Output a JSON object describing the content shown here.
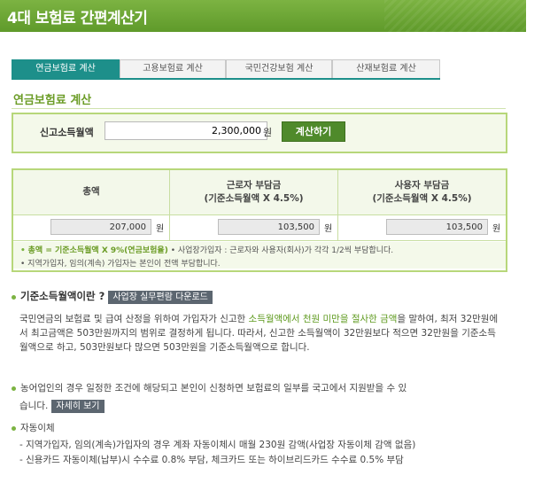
{
  "header": {
    "title": "4대 보험료 간편계산기"
  },
  "tabs": [
    {
      "label": "연금보험료 계산",
      "active": true
    },
    {
      "label": "고용보험료 계산",
      "active": false
    },
    {
      "label": "국민건강보험 계산",
      "active": false
    },
    {
      "label": "산재보험료 계산",
      "active": false
    }
  ],
  "section": {
    "title": "연금보험료 계산"
  },
  "income": {
    "label": "신고소득월액",
    "value": "2,300,000",
    "unit": "원",
    "button_label": "계산하기"
  },
  "result": {
    "col1_header": "총액",
    "col2_header_1": "근로자 부담금",
    "col2_header_2": "(기준소득월액 X 4.5%)",
    "col3_header_1": "사용자 부담금",
    "col3_header_2": "(기준소득월액 X 4.5%)",
    "total": "207,000",
    "employee": "103,500",
    "employer": "103,500",
    "unit": "원",
    "note1_bullet": "•",
    "note1_hl": "총액 = 기준소득월액 X 9%(연금보험율)",
    "note1_rest": "• 사업장가입자 : 근로자와 사용자(회사)가 각각 1/2씩 부담합니다.",
    "note2": "• 지역가입자, 임의(계속) 가입자는 본인이 전액 부담합니다."
  },
  "info": {
    "q_title": "기준소득월액이란 ?",
    "download_button": "사업장 실무편람 다운로드",
    "p1_a": "국민연금의 보험료 및 급여 산정을 위하여 가입자가 신고한 ",
    "p1_hl": "소득월액에서 천원 미만을 절사한 금액",
    "p1_b": "을 말하여, 최저 32만원에서 최고금액은 503만원까지의 범위로 결정하게 됩니다. 따라서, 신고한 소득월액이 32만원보다 적으면 32만원을 기준소득월액으로 하고, 503만원보다 많으면 503만원을 기준소득월액으로 합니다.",
    "farmer_line1": "농어업인의 경우 일정한 조건에 해당되고 본인이 신청하면 보험료의 일부를 국고에서 지원받을 수 있",
    "farmer_line2": "습니다.",
    "detail_button": "자세히 보기",
    "autopay_title": "자동이체",
    "autopay_1": "- 지역가입자, 임의(계속)가입자의 경우 계좌 자동이체시 매월 230원 감액(사업장 자동이체 감액 없음)",
    "autopay_2": "- 신용카드 자동이체(납부)시 수수료 0.8% 부담, 체크카드 또는 하이브리드카드 수수료 0.5% 부담"
  }
}
